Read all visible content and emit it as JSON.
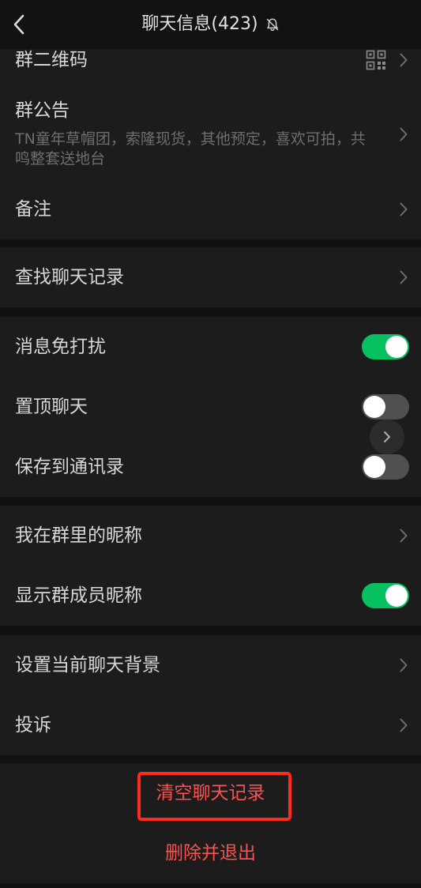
{
  "colors": {
    "accent_green": "#07c160",
    "danger_red": "#fa5151",
    "highlight_red": "#ff2b1c"
  },
  "header": {
    "title": "聊天信息(423)",
    "back_icon": "chevron-left-icon",
    "status_icon": "bell-off-icon"
  },
  "group_info": {
    "qr_code": {
      "label": "群二维码",
      "icon": "qr-code-icon"
    },
    "announcement": {
      "label": "群公告",
      "lines": [
        "TN童年草帽团，索隆现货，其他预定，喜欢可拍，共",
        "鸣整套送地台"
      ]
    },
    "remark": {
      "label": "备注"
    }
  },
  "search": {
    "label": "查找聊天记录"
  },
  "chat_settings": {
    "mute": {
      "label": "消息免打扰",
      "on": true
    },
    "pin": {
      "label": "置顶聊天",
      "on": false
    },
    "save_to_contacts": {
      "label": "保存到通讯录",
      "on": false
    }
  },
  "nickname": {
    "my_nickname": {
      "label": "我在群里的昵称"
    },
    "show_member_nicknames": {
      "label": "显示群成员昵称",
      "on": true
    }
  },
  "more": {
    "chat_background": {
      "label": "设置当前聊天背景"
    },
    "complain": {
      "label": "投诉"
    }
  },
  "actions": {
    "clear_history": "清空聊天记录",
    "delete_and_exit": "删除并退出"
  },
  "overlay": {
    "floating_button_icon": "chevron-right-icon"
  }
}
